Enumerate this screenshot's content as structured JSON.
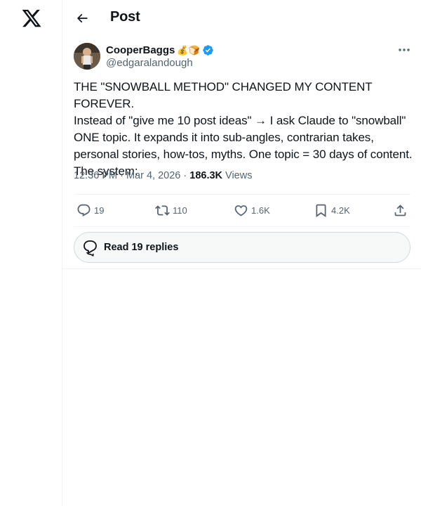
{
  "nav": {
    "logo_icon": "x-logo-icon",
    "back_icon": "arrow-left-icon"
  },
  "header": {
    "title": "Post"
  },
  "post": {
    "author": {
      "display_name": "CooperBaggs",
      "emojis": "💰🍞",
      "verified": true,
      "verified_color": "#1d9bf0",
      "handle": "@edgaralandough"
    },
    "text": "THE \"SNOWBALL METHOD\" CHANGED MY CONTENT FOREVER.\nInstead of \"give me 10 post ideas\" → I ask Claude to \"snowball\" ONE topic. It expands it into sub-angles, contrarian takes, personal stories, how-tos, myths. One topic = 30 days of content. The system:",
    "time": "12:36 PM",
    "separator": "·",
    "date": "Mar 4, 2026",
    "views_count": "186.3K",
    "views_label": "Views",
    "actions": {
      "replies": "19",
      "reposts": "110",
      "likes": "1.6K",
      "bookmarks": "4.2K"
    },
    "read_replies_label": "Read 19 replies"
  },
  "colors": {
    "text_primary": "#0f1419",
    "text_secondary": "#536471",
    "border": "#eff3f4",
    "accent": "#1d9bf0"
  }
}
